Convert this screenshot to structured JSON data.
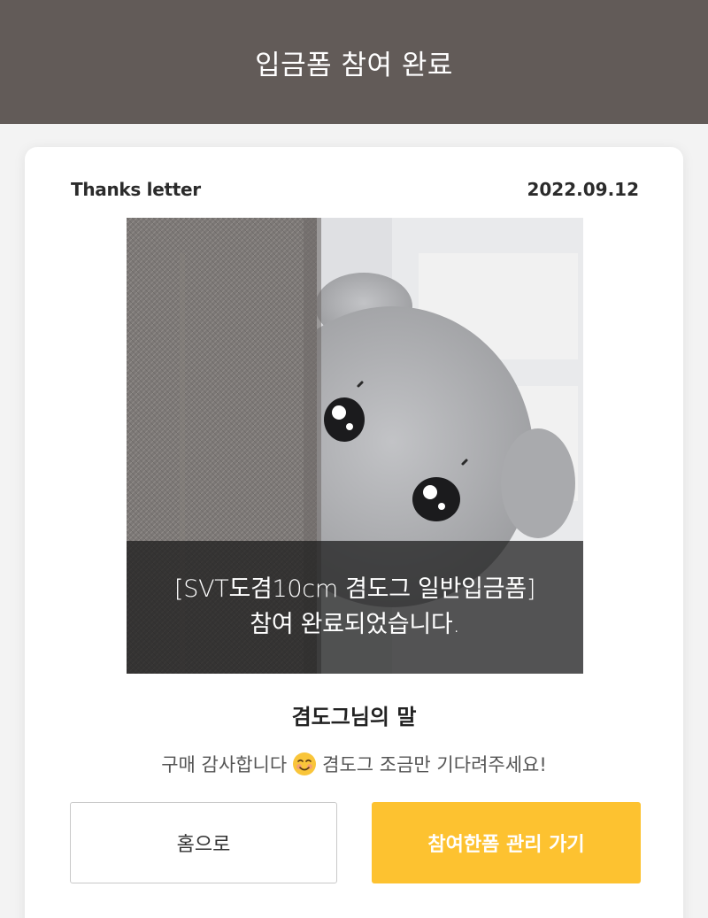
{
  "header": {
    "title": "입금폼 참여 완료"
  },
  "card": {
    "label": "Thanks letter",
    "date": "2022.09.12",
    "image_overlay": {
      "line1": "[SVT도겸10cm 겸도그 일반입금폼]",
      "line2": "참여 완료되었습니다."
    },
    "seller_title": "겸도그님의 말",
    "seller_message_part1": "구매 감사합니다",
    "seller_message_icon": "smiling-face-icon",
    "seller_message_part2": "겸도그 조금만 기다려주세요!"
  },
  "buttons": {
    "home_label": "홈으로",
    "manage_label": "참여한폼 관리 가기"
  },
  "colors": {
    "header_bg": "#625b58",
    "accent": "#fdc230"
  }
}
